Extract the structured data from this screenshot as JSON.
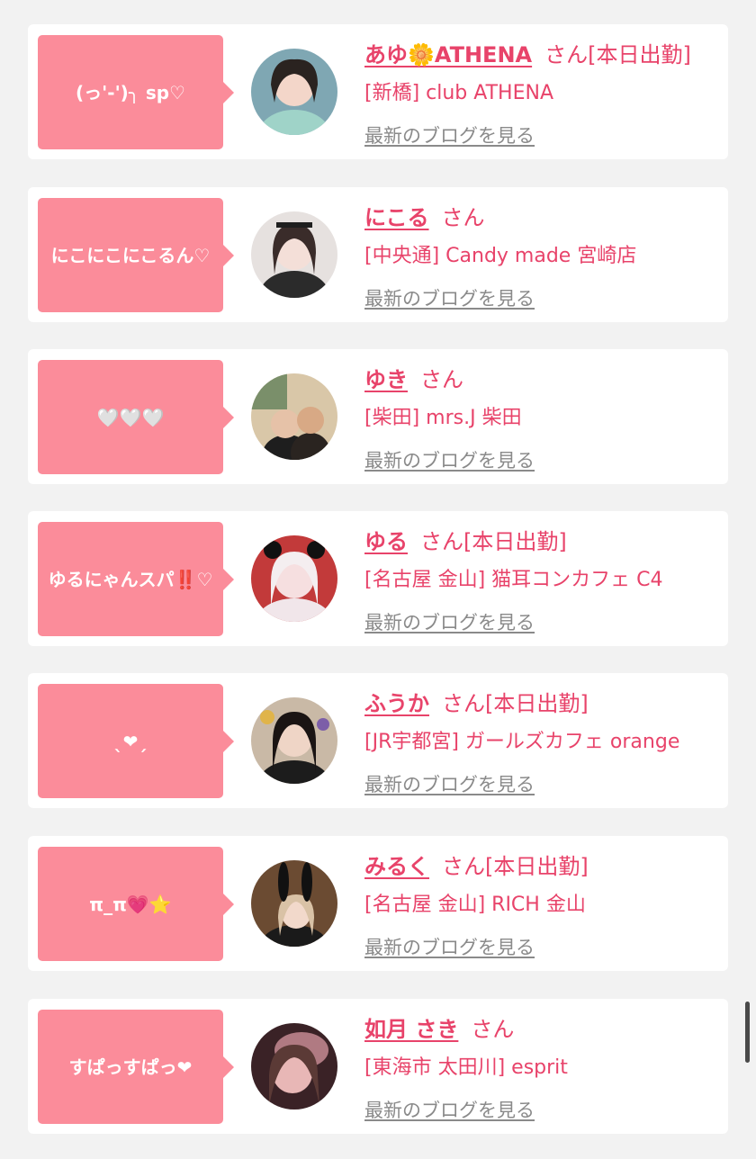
{
  "labels": {
    "san": "さん",
    "blog_link": "最新のブログを見る"
  },
  "colors": {
    "accent": "#e8436a",
    "bubble": "#fb8c9a",
    "background": "#f2f2f2",
    "link_gray": "#8a8a8a"
  },
  "cards": [
    {
      "bubble": "(っ'-')╮ sp♡",
      "name": "あゆ🌼ATHENA",
      "status": "[本日出勤]",
      "shop": "[新橋] club ATHENA"
    },
    {
      "bubble": "にこにこにこるん♡",
      "name": "にこる",
      "status": "",
      "shop": "[中央通] Candy made 宮崎店"
    },
    {
      "bubble": "🤍🤍🤍",
      "name": "ゆき",
      "status": "",
      "shop": "[柴田] mrs.J 柴田"
    },
    {
      "bubble": "ゆるにゃんスパ‼️♡",
      "name": "ゆる",
      "status": "[本日出勤]",
      "shop": "[名古屋 金山] 猫耳コンカフェ C4"
    },
    {
      "bubble": "ˎ❤︎ˏ",
      "name": "ふうか",
      "status": "[本日出勤]",
      "shop": "[JR宇都宮] ガールズカフェ orange"
    },
    {
      "bubble": "π_π💗⭐",
      "name": "みるく",
      "status": "[本日出勤]",
      "shop": "[名古屋 金山] RICH 金山"
    },
    {
      "bubble": "すぱっすぱっ❤",
      "name": "如月 さき",
      "status": "",
      "shop": "[東海市 太田川] esprit"
    }
  ]
}
